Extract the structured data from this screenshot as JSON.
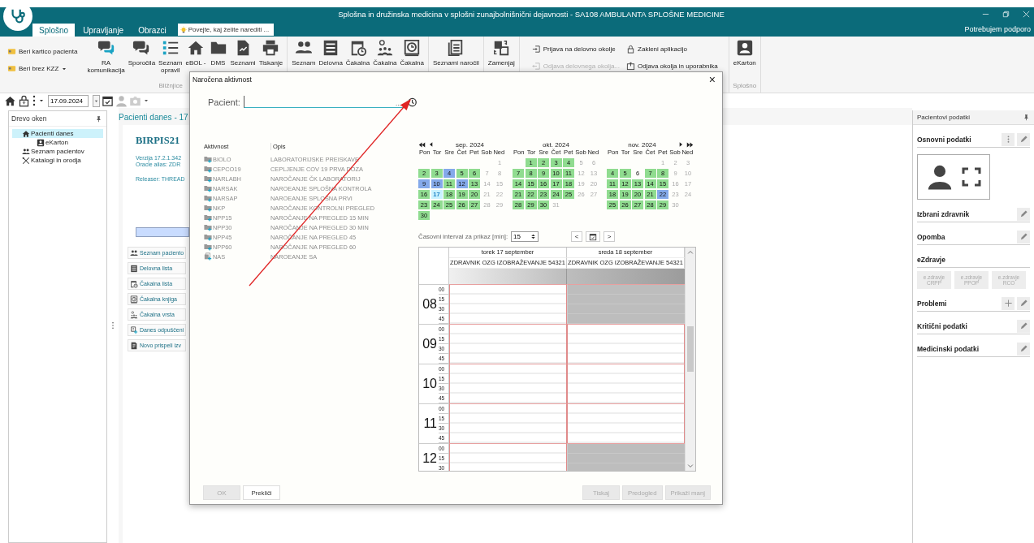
{
  "window": {
    "title": "Splošna in družinska medicina v splošni zunajbolnišnični dejavnosti - SA108 AMBULANTA SPLOŠNE MEDICINE"
  },
  "tabs": [
    {
      "label": "Splošno",
      "selected": true
    },
    {
      "label": "Upravljanje",
      "selected": false
    },
    {
      "label": "Obrazci",
      "selected": false
    }
  ],
  "search": {
    "placeholder": "Povejte, kaj želite narediti ..."
  },
  "support_link": "Potrebujem podporo",
  "ribbon": {
    "groups": [
      {
        "kind": "stack",
        "buttons": [
          {
            "label": "Beri kartico pacienta",
            "dropdown": false
          },
          {
            "label": "Beri brez KZZ",
            "dropdown": true
          }
        ]
      },
      {
        "kind": "large",
        "caption": "Bližnjice",
        "buttons": [
          {
            "label": "RA\nkomunikacija"
          },
          {
            "label": "Sporočila"
          },
          {
            "label": "Seznam\nopravil"
          },
          {
            "label": "eBOL -"
          },
          {
            "label": "DMS"
          },
          {
            "label": "Seznami"
          },
          {
            "label": "Tiskanje"
          }
        ]
      },
      {
        "kind": "large",
        "buttons": [
          {
            "label": "Seznam"
          },
          {
            "label": "Delovna"
          },
          {
            "label": "Čakalna"
          },
          {
            "label": "Čakalna"
          },
          {
            "label": "Čakalna"
          }
        ]
      },
      {
        "kind": "large",
        "buttons": [
          {
            "label": "Seznami naročil"
          }
        ]
      },
      {
        "kind": "large",
        "buttons": [
          {
            "label": "Zamenjaj"
          }
        ]
      },
      {
        "kind": "grid",
        "buttons": [
          {
            "label": "Prijava na delovno okolje",
            "disabled": false
          },
          {
            "label": "Zakleni aplikacijo",
            "disabled": false
          },
          {
            "label": "Odjava delovnega okolja...",
            "disabled": true
          },
          {
            "label": "Odjava okolja in uporabnika",
            "disabled": false
          }
        ]
      },
      {
        "kind": "large",
        "caption": "Splošno",
        "buttons": [
          {
            "label": "eKarton"
          }
        ]
      }
    ]
  },
  "toolbar": {
    "date": "17.09.2024"
  },
  "window_tree": {
    "title": "Drevo oken",
    "items": [
      {
        "label": "Pacienti danes",
        "selected": true,
        "children": [
          {
            "label": "eKarton",
            "selected": false
          }
        ]
      },
      {
        "label": "Seznam pacientov",
        "selected": false
      },
      {
        "label": "Katalogi in orodja",
        "selected": false
      }
    ]
  },
  "patients_today": {
    "title": "Pacienti danes - 17",
    "app_name": "BIRPIS21",
    "version": "Verzija 17.2.1.342",
    "oracle_alias": "Oracle alias: ZDR",
    "releaser": "Releaser: THREAD",
    "shortcuts": [
      "Seznam paciento",
      "Delovna lista",
      "Čakalna lista",
      "Čakalna knjiga",
      "Čakalna vrsta",
      "Danes odpuščeni",
      "Novo prispeli izv"
    ]
  },
  "patient_panel": {
    "title": "Pacientovi podatki",
    "sections": [
      {
        "title": "Osnovni podatki",
        "kind": "profile"
      },
      {
        "title": "Izbrani zdravnik",
        "kind": "editable"
      },
      {
        "title": "Opomba",
        "kind": "editable"
      },
      {
        "title": "eZdravje",
        "kind": "services",
        "services": [
          {
            "label": "e.zdravje",
            "code": "CRPP"
          },
          {
            "label": "e.zdravje",
            "code": "PPOP"
          },
          {
            "label": "e.zdravje",
            "code": "RCO"
          }
        ]
      },
      {
        "title": "Problemi",
        "kind": "addable"
      },
      {
        "title": "Kritični podatki",
        "kind": "editable"
      },
      {
        "title": "Medicinski podatki",
        "kind": "editable"
      }
    ]
  },
  "dialog": {
    "title": "Naročena aktivnost",
    "close": "×",
    "patient_label": "Pacient:",
    "browse": "...",
    "activities": {
      "columns": [
        "Aktivnost",
        "Opis"
      ],
      "rows": [
        {
          "code": "BIOLO",
          "description": "LABORATORIJSKE PREISKAVE",
          "kind": "folder"
        },
        {
          "code": "CEPCO19",
          "description": "CEPLJENJE COV 19 PRVA DOZA",
          "kind": "folder"
        },
        {
          "code": "NARLABH",
          "description": "NAROČANJE ČK LABORATORIJ",
          "kind": "folder"
        },
        {
          "code": "NARSAK",
          "description": "NAROEANJE SPLOŠNA KONTROLA",
          "kind": "folder"
        },
        {
          "code": "NARSAP",
          "description": "NAROEANJE SPLOŠNA PRVI",
          "kind": "folder"
        },
        {
          "code": "NKP",
          "description": "NAROČANJE KONTROLNI PREGLED",
          "kind": "folder"
        },
        {
          "code": "NPP15",
          "description": "NAROČANJE NA PREGLED 15 MIN",
          "kind": "folder"
        },
        {
          "code": "NPP30",
          "description": "NAROČANJE NA PREGLED 30 MIN",
          "kind": "folder"
        },
        {
          "code": "NPP45",
          "description": "NAROČANJE NA PREGLED 45",
          "kind": "folder"
        },
        {
          "code": "NPP60",
          "description": "NAROČANJE NA PREGLED 60",
          "kind": "folder"
        },
        {
          "code": "NAS",
          "description": "NAROEANJE SA",
          "kind": "pages"
        }
      ]
    },
    "calendar": {
      "months": [
        {
          "title": "sep. 2024",
          "weekdays": [
            "Pon",
            "Tor",
            "Sre",
            "Čet",
            "Pet",
            "Sob",
            "Ned"
          ],
          "weeks": [
            [
              {
                "day": "1",
                "disabled": true,
                "selected": false
              }
            ],
            [
              {
                "day": "2",
                "color": "#90dc90",
                "disabled": false,
                "selected": false
              },
              {
                "day": "3",
                "color": "#90dc90",
                "disabled": false,
                "selected": false
              },
              {
                "day": "4",
                "color": "#84a9ea",
                "disabled": false,
                "selected": false
              },
              {
                "day": "5",
                "color": "#90dc90",
                "disabled": false,
                "selected": false
              },
              {
                "day": "6",
                "color": "#90dc90",
                "disabled": false,
                "selected": false
              },
              {
                "day": "7",
                "disabled": true,
                "selected": false
              },
              {
                "day": "8",
                "disabled": true,
                "selected": false
              }
            ],
            [
              {
                "day": "9",
                "color": "#84a9ea",
                "disabled": false,
                "selected": false
              },
              {
                "day": "10",
                "color": "#84a9ea",
                "disabled": false,
                "selected": false
              },
              {
                "day": "11",
                "color": "#90dc90",
                "disabled": false,
                "selected": false
              },
              {
                "day": "12",
                "color": "#84a9ea",
                "disabled": false,
                "selected": false
              },
              {
                "day": "13",
                "color": "#90dc90",
                "disabled": false,
                "selected": false
              },
              {
                "day": "14",
                "disabled": true,
                "selected": false
              },
              {
                "day": "15",
                "disabled": true,
                "selected": false
              }
            ],
            [
              {
                "day": "16",
                "color": "#90dc90",
                "disabled": false,
                "selected": false
              },
              {
                "day": "17",
                "color": "#c8f2ff",
                "disabled": false,
                "selected": true
              },
              {
                "day": "18",
                "color": "#90dc90",
                "disabled": false,
                "selected": false
              },
              {
                "day": "19",
                "color": "#90dc90",
                "disabled": false,
                "selected": false
              },
              {
                "day": "20",
                "color": "#90dc90",
                "disabled": false,
                "selected": false
              },
              {
                "day": "21",
                "disabled": true,
                "selected": false
              },
              {
                "day": "22",
                "disabled": true,
                "selected": false
              }
            ],
            [
              {
                "day": "23",
                "color": "#90dc90",
                "disabled": false,
                "selected": false
              },
              {
                "day": "24",
                "color": "#90dc90",
                "disabled": false,
                "selected": false
              },
              {
                "day": "25",
                "color": "#90dc90",
                "disabled": false,
                "selected": false
              },
              {
                "day": "26",
                "color": "#90dc90",
                "disabled": false,
                "selected": false
              },
              {
                "day": "27",
                "color": "#90dc90",
                "disabled": false,
                "selected": false
              },
              {
                "day": "28",
                "disabled": true,
                "selected": false
              },
              {
                "day": "29",
                "disabled": true,
                "selected": false
              }
            ],
            [
              {
                "day": "30",
                "color": "#90dc90",
                "disabled": false,
                "selected": false
              }
            ]
          ]
        },
        {
          "title": "okt. 2024",
          "weekdays": [
            "Pon",
            "Tor",
            "Sre",
            "Čet",
            "Pet",
            "Sob",
            "Ned"
          ],
          "weeks": [
            [
              {
                "day": "1",
                "color": "#90dc90",
                "disabled": false,
                "selected": false
              },
              {
                "day": "2",
                "color": "#90dc90",
                "disabled": false,
                "selected": false
              },
              {
                "day": "3",
                "color": "#90dc90",
                "disabled": false,
                "selected": false
              },
              {
                "day": "4",
                "color": "#90dc90",
                "disabled": false,
                "selected": false
              },
              {
                "day": "5",
                "disabled": true,
                "selected": false
              },
              {
                "day": "6",
                "disabled": true,
                "selected": false
              }
            ],
            [
              {
                "day": "7",
                "color": "#90dc90",
                "disabled": false,
                "selected": false
              },
              {
                "day": "8",
                "color": "#90dc90",
                "disabled": false,
                "selected": false
              },
              {
                "day": "9",
                "color": "#90dc90",
                "disabled": false,
                "selected": false
              },
              {
                "day": "10",
                "color": "#90dc90",
                "disabled": false,
                "selected": false
              },
              {
                "day": "11",
                "color": "#90dc90",
                "disabled": false,
                "selected": false
              },
              {
                "day": "12",
                "disabled": true,
                "selected": false
              },
              {
                "day": "13",
                "disabled": true,
                "selected": false
              }
            ],
            [
              {
                "day": "14",
                "color": "#90dc90",
                "disabled": false,
                "selected": false
              },
              {
                "day": "15",
                "color": "#90dc90",
                "disabled": false,
                "selected": false
              },
              {
                "day": "16",
                "color": "#90dc90",
                "disabled": false,
                "selected": false
              },
              {
                "day": "17",
                "color": "#90dc90",
                "disabled": false,
                "selected": false
              },
              {
                "day": "18",
                "color": "#90dc90",
                "disabled": false,
                "selected": false
              },
              {
                "day": "19",
                "disabled": true,
                "selected": false
              },
              {
                "day": "20",
                "disabled": true,
                "selected": false
              }
            ],
            [
              {
                "day": "21",
                "color": "#90dc90",
                "disabled": false,
                "selected": false
              },
              {
                "day": "22",
                "color": "#90dc90",
                "disabled": false,
                "selected": false
              },
              {
                "day": "23",
                "color": "#90dc90",
                "disabled": false,
                "selected": false
              },
              {
                "day": "24",
                "color": "#90dc90",
                "disabled": false,
                "selected": false
              },
              {
                "day": "25",
                "color": "#90dc90",
                "disabled": false,
                "selected": false
              },
              {
                "day": "26",
                "disabled": true,
                "selected": false
              },
              {
                "day": "27",
                "disabled": true,
                "selected": false
              }
            ],
            [
              {
                "day": "28",
                "color": "#90dc90",
                "disabled": false,
                "selected": false
              },
              {
                "day": "29",
                "color": "#90dc90",
                "disabled": false,
                "selected": false
              },
              {
                "day": "30",
                "color": "#90dc90",
                "disabled": false,
                "selected": false
              },
              {
                "day": "31",
                "disabled": true,
                "selected": false
              }
            ]
          ]
        },
        {
          "title": "nov. 2024",
          "weekdays": [
            "Pon",
            "Tor",
            "Sre",
            "Čet",
            "Pet",
            "Sob",
            "Ned"
          ],
          "weeks": [
            [
              {
                "day": "1",
                "disabled": true,
                "selected": false
              },
              {
                "day": "2",
                "disabled": true,
                "selected": false
              },
              {
                "day": "3",
                "disabled": true,
                "selected": false
              }
            ],
            [
              {
                "day": "4",
                "color": "#90dc90",
                "disabled": false,
                "selected": false
              },
              {
                "day": "5",
                "color": "#90dc90",
                "disabled": false,
                "selected": false
              },
              {
                "day": "6",
                "disabled": false,
                "selected": false
              },
              {
                "day": "7",
                "color": "#90dc90",
                "disabled": false,
                "selected": false
              },
              {
                "day": "8",
                "color": "#90dc90",
                "disabled": false,
                "selected": false
              },
              {
                "day": "9",
                "disabled": true,
                "selected": false
              },
              {
                "day": "10",
                "disabled": true,
                "selected": false
              }
            ],
            [
              {
                "day": "11",
                "color": "#90dc90",
                "disabled": false,
                "selected": false
              },
              {
                "day": "12",
                "color": "#90dc90",
                "disabled": false,
                "selected": false
              },
              {
                "day": "13",
                "color": "#90dc90",
                "disabled": false,
                "selected": false
              },
              {
                "day": "14",
                "color": "#90dc90",
                "disabled": false,
                "selected": false
              },
              {
                "day": "15",
                "color": "#90dc90",
                "disabled": false,
                "selected": false
              },
              {
                "day": "16",
                "disabled": true,
                "selected": false
              },
              {
                "day": "17",
                "disabled": true,
                "selected": false
              }
            ],
            [
              {
                "day": "18",
                "color": "#90dc90",
                "disabled": false,
                "selected": false
              },
              {
                "day": "19",
                "color": "#90dc90",
                "disabled": false,
                "selected": false
              },
              {
                "day": "20",
                "color": "#90dc90",
                "disabled": false,
                "selected": false
              },
              {
                "day": "21",
                "color": "#90dc90",
                "disabled": false,
                "selected": false
              },
              {
                "day": "22",
                "color": "#84a9ea",
                "disabled": false,
                "selected": false
              },
              {
                "day": "23",
                "disabled": true,
                "selected": false
              },
              {
                "day": "24",
                "disabled": true,
                "selected": false
              }
            ],
            [
              {
                "day": "25",
                "color": "#90dc90",
                "disabled": false,
                "selected": false
              },
              {
                "day": "26",
                "color": "#90dc90",
                "disabled": false,
                "selected": false
              },
              {
                "day": "27",
                "color": "#90dc90",
                "disabled": false,
                "selected": false
              },
              {
                "day": "28",
                "color": "#90dc90",
                "disabled": false,
                "selected": false
              },
              {
                "day": "29",
                "color": "#90dc90",
                "disabled": false,
                "selected": false
              },
              {
                "day": "30",
                "disabled": true,
                "selected": false
              }
            ]
          ]
        }
      ]
    },
    "interval": {
      "label": "Časovni interval za prikaz [min]:",
      "value": "15",
      "prev": "<",
      "next": ">"
    },
    "schedule": {
      "columns": [
        {
          "day": "torek 17 september",
          "doctor": "ZDRAVNIK OZG IZOBRAŽEVANJE 54321"
        },
        {
          "day": "sreda 18 september",
          "doctor": "ZDRAVNIK OZG IZOBRAŽEVANJE 54321"
        }
      ],
      "hours": [
        {
          "hour": "08",
          "minutes": [
            "00",
            "15",
            "30",
            "45"
          ],
          "open": [
            true,
            false
          ]
        },
        {
          "hour": "09",
          "minutes": [
            "00",
            "15",
            "30",
            "45"
          ],
          "open": [
            true,
            true
          ]
        },
        {
          "hour": "10",
          "minutes": [
            "00",
            "15",
            "30",
            "45"
          ],
          "open": [
            true,
            true
          ]
        },
        {
          "hour": "11",
          "minutes": [
            "00",
            "15",
            "30",
            "45"
          ],
          "open": [
            true,
            true
          ]
        },
        {
          "hour": "12",
          "minutes": [
            "00",
            "15",
            "30"
          ],
          "open": [
            true,
            false
          ]
        }
      ]
    },
    "buttons": [
      {
        "label": "OK",
        "disabled": true
      },
      {
        "label": "Prekliči",
        "disabled": false
      },
      {
        "label": "Tiskaj",
        "disabled": true
      },
      {
        "label": "Predogled",
        "disabled": true
      },
      {
        "label": "Prikaži manj",
        "disabled": true
      }
    ]
  }
}
